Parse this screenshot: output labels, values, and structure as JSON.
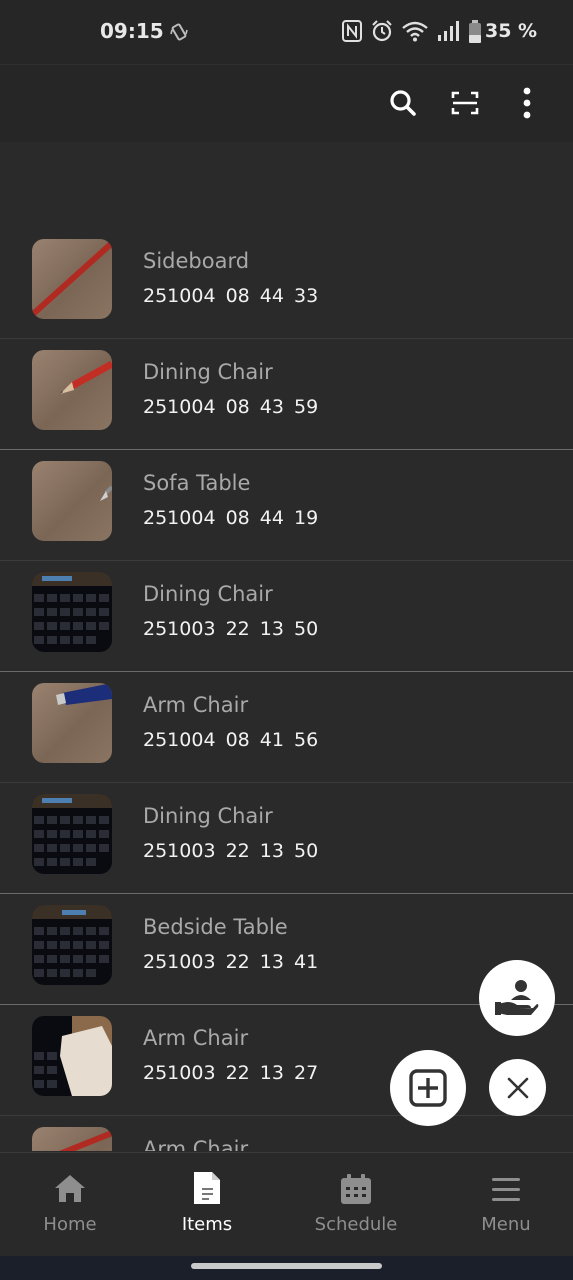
{
  "status_bar": {
    "time": "09:15",
    "battery": "35 %",
    "icons": [
      "vibrate-icon",
      "nfc-icon",
      "alarm-icon",
      "wifi-icon",
      "signal-icon",
      "battery-icon"
    ]
  },
  "toolbar": {
    "icons": [
      "search-icon",
      "scan-icon",
      "more-vert-icon"
    ]
  },
  "items": [
    {
      "title": "Sideboard",
      "code": "251004 08 44 33",
      "thumb": "pencil-on-wood"
    },
    {
      "title": "Dining Chair",
      "code": "251004 08 43 59",
      "thumb": "pencil-on-wood"
    },
    {
      "title": "Sofa Table",
      "code": "251004 08 44 19",
      "thumb": "pencil-on-wood"
    },
    {
      "title": "Dining Chair",
      "code": "251003 22 13 50",
      "thumb": "keyboard"
    },
    {
      "title": "Arm Chair",
      "code": "251004 08 41 56",
      "thumb": "pen-on-wood"
    },
    {
      "title": "Dining Chair",
      "code": "251003 22 13 50",
      "thumb": "keyboard"
    },
    {
      "title": "Bedside Table",
      "code": "251003 22 13 41",
      "thumb": "keyboard"
    },
    {
      "title": "Arm Chair",
      "code": "251003 22 13 27",
      "thumb": "keyboard-cloth"
    },
    {
      "title": "Arm Chair",
      "code": "",
      "thumb": "pencil-on-wood"
    }
  ],
  "fabs": {
    "handover": "hand-person-icon",
    "add": "add-box-icon",
    "close": "close-icon"
  },
  "nav": {
    "items": [
      {
        "label": "Home",
        "icon": "home-icon",
        "active": false
      },
      {
        "label": "Items",
        "icon": "document-icon",
        "active": true
      },
      {
        "label": "Schedule",
        "icon": "calendar-icon",
        "active": false
      },
      {
        "label": "Menu",
        "icon": "hamburger-icon",
        "active": false
      }
    ]
  },
  "colors": {
    "background": "#2a2a2b",
    "bar": "#262627",
    "title_text": "#a9a9aa",
    "code_text": "#f2f2f2",
    "fab": "#ffffff"
  }
}
